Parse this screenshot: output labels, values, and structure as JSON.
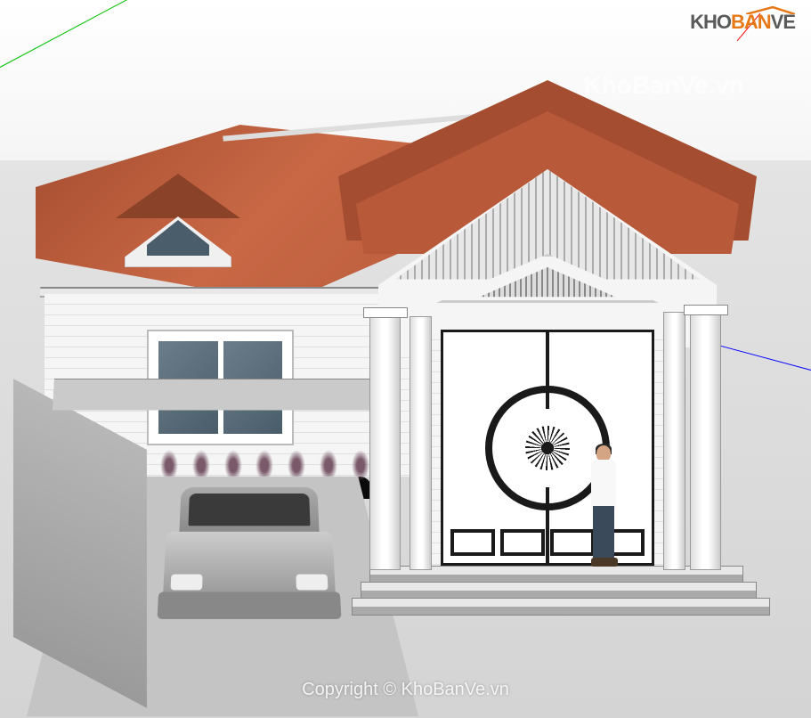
{
  "watermarks": {
    "center": "KhoBanVe.vn",
    "copyright": "Copyright © KhoBanVe.vn"
  },
  "logo": {
    "text_part1": "KHO",
    "text_part2": "BAN",
    "text_part3": "VE"
  },
  "scene": {
    "model_type": "single-story-house",
    "roof_color": "#b85a3a",
    "wall_color": "#f5f5f5",
    "axes": {
      "green": "#00c000",
      "blue": "#0000ff",
      "red": "#ff0000"
    }
  }
}
